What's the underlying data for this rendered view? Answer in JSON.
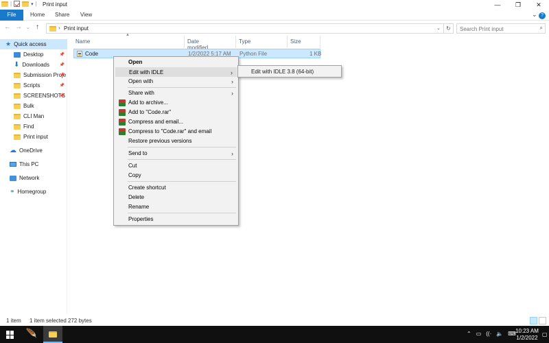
{
  "window": {
    "title": "Print input"
  },
  "ribbon": {
    "file": "File",
    "tabs": [
      "Home",
      "Share",
      "View"
    ]
  },
  "address": {
    "path": "Print input",
    "search_placeholder": "Search Print input"
  },
  "sidebar": {
    "items": [
      {
        "label": "Quick access",
        "icon": "star-icon"
      },
      {
        "label": "Desktop",
        "icon": "desktop-icon",
        "pinned": true
      },
      {
        "label": "Downloads",
        "icon": "downloads-icon",
        "pinned": true
      },
      {
        "label": "Submission Proje",
        "icon": "folder-icon",
        "pinned": true
      },
      {
        "label": "Scripts",
        "icon": "folder-icon",
        "pinned": true
      },
      {
        "label": "SCREENSHOTS",
        "icon": "folder-icon",
        "pinned": true
      },
      {
        "label": "Bulk",
        "icon": "folder-icon"
      },
      {
        "label": "CLI Man",
        "icon": "folder-icon"
      },
      {
        "label": "Find",
        "icon": "folder-icon"
      },
      {
        "label": "Print input",
        "icon": "folder-icon"
      },
      {
        "label": "OneDrive",
        "icon": "cloud-icon"
      },
      {
        "label": "This PC",
        "icon": "pc-icon"
      },
      {
        "label": "Network",
        "icon": "network-icon"
      },
      {
        "label": "Homegroup",
        "icon": "homegroup-icon"
      }
    ]
  },
  "columns": {
    "name": "Name",
    "date": "Date modified",
    "type": "Type",
    "size": "Size"
  },
  "file": {
    "name": "Code",
    "date": "1/2/2022 5:17 AM",
    "type": "Python File",
    "size": "1 KB"
  },
  "context_menu": {
    "open": "Open",
    "edit_idle": "Edit with IDLE",
    "open_with": "Open with",
    "share_with": "Share with",
    "add_archive": "Add to archive...",
    "add_rar": "Add to \"Code.rar\"",
    "compress_email": "Compress and email...",
    "compress_rar_email": "Compress to \"Code.rar\" and email",
    "restore": "Restore previous versions",
    "send_to": "Send to",
    "cut": "Cut",
    "copy": "Copy",
    "create_shortcut": "Create shortcut",
    "delete": "Delete",
    "rename": "Rename",
    "properties": "Properties"
  },
  "submenu": {
    "item": "Edit with IDLE 3.8 (64-bit)"
  },
  "status": {
    "count": "1 item",
    "selected": "1 item selected  272 bytes"
  },
  "taskbar": {
    "time": "10:23 AM",
    "date": "1/2/2022"
  },
  "colors": {
    "accent": "#1979ca",
    "selection": "#cce8ff",
    "taskbar": "#101010"
  }
}
